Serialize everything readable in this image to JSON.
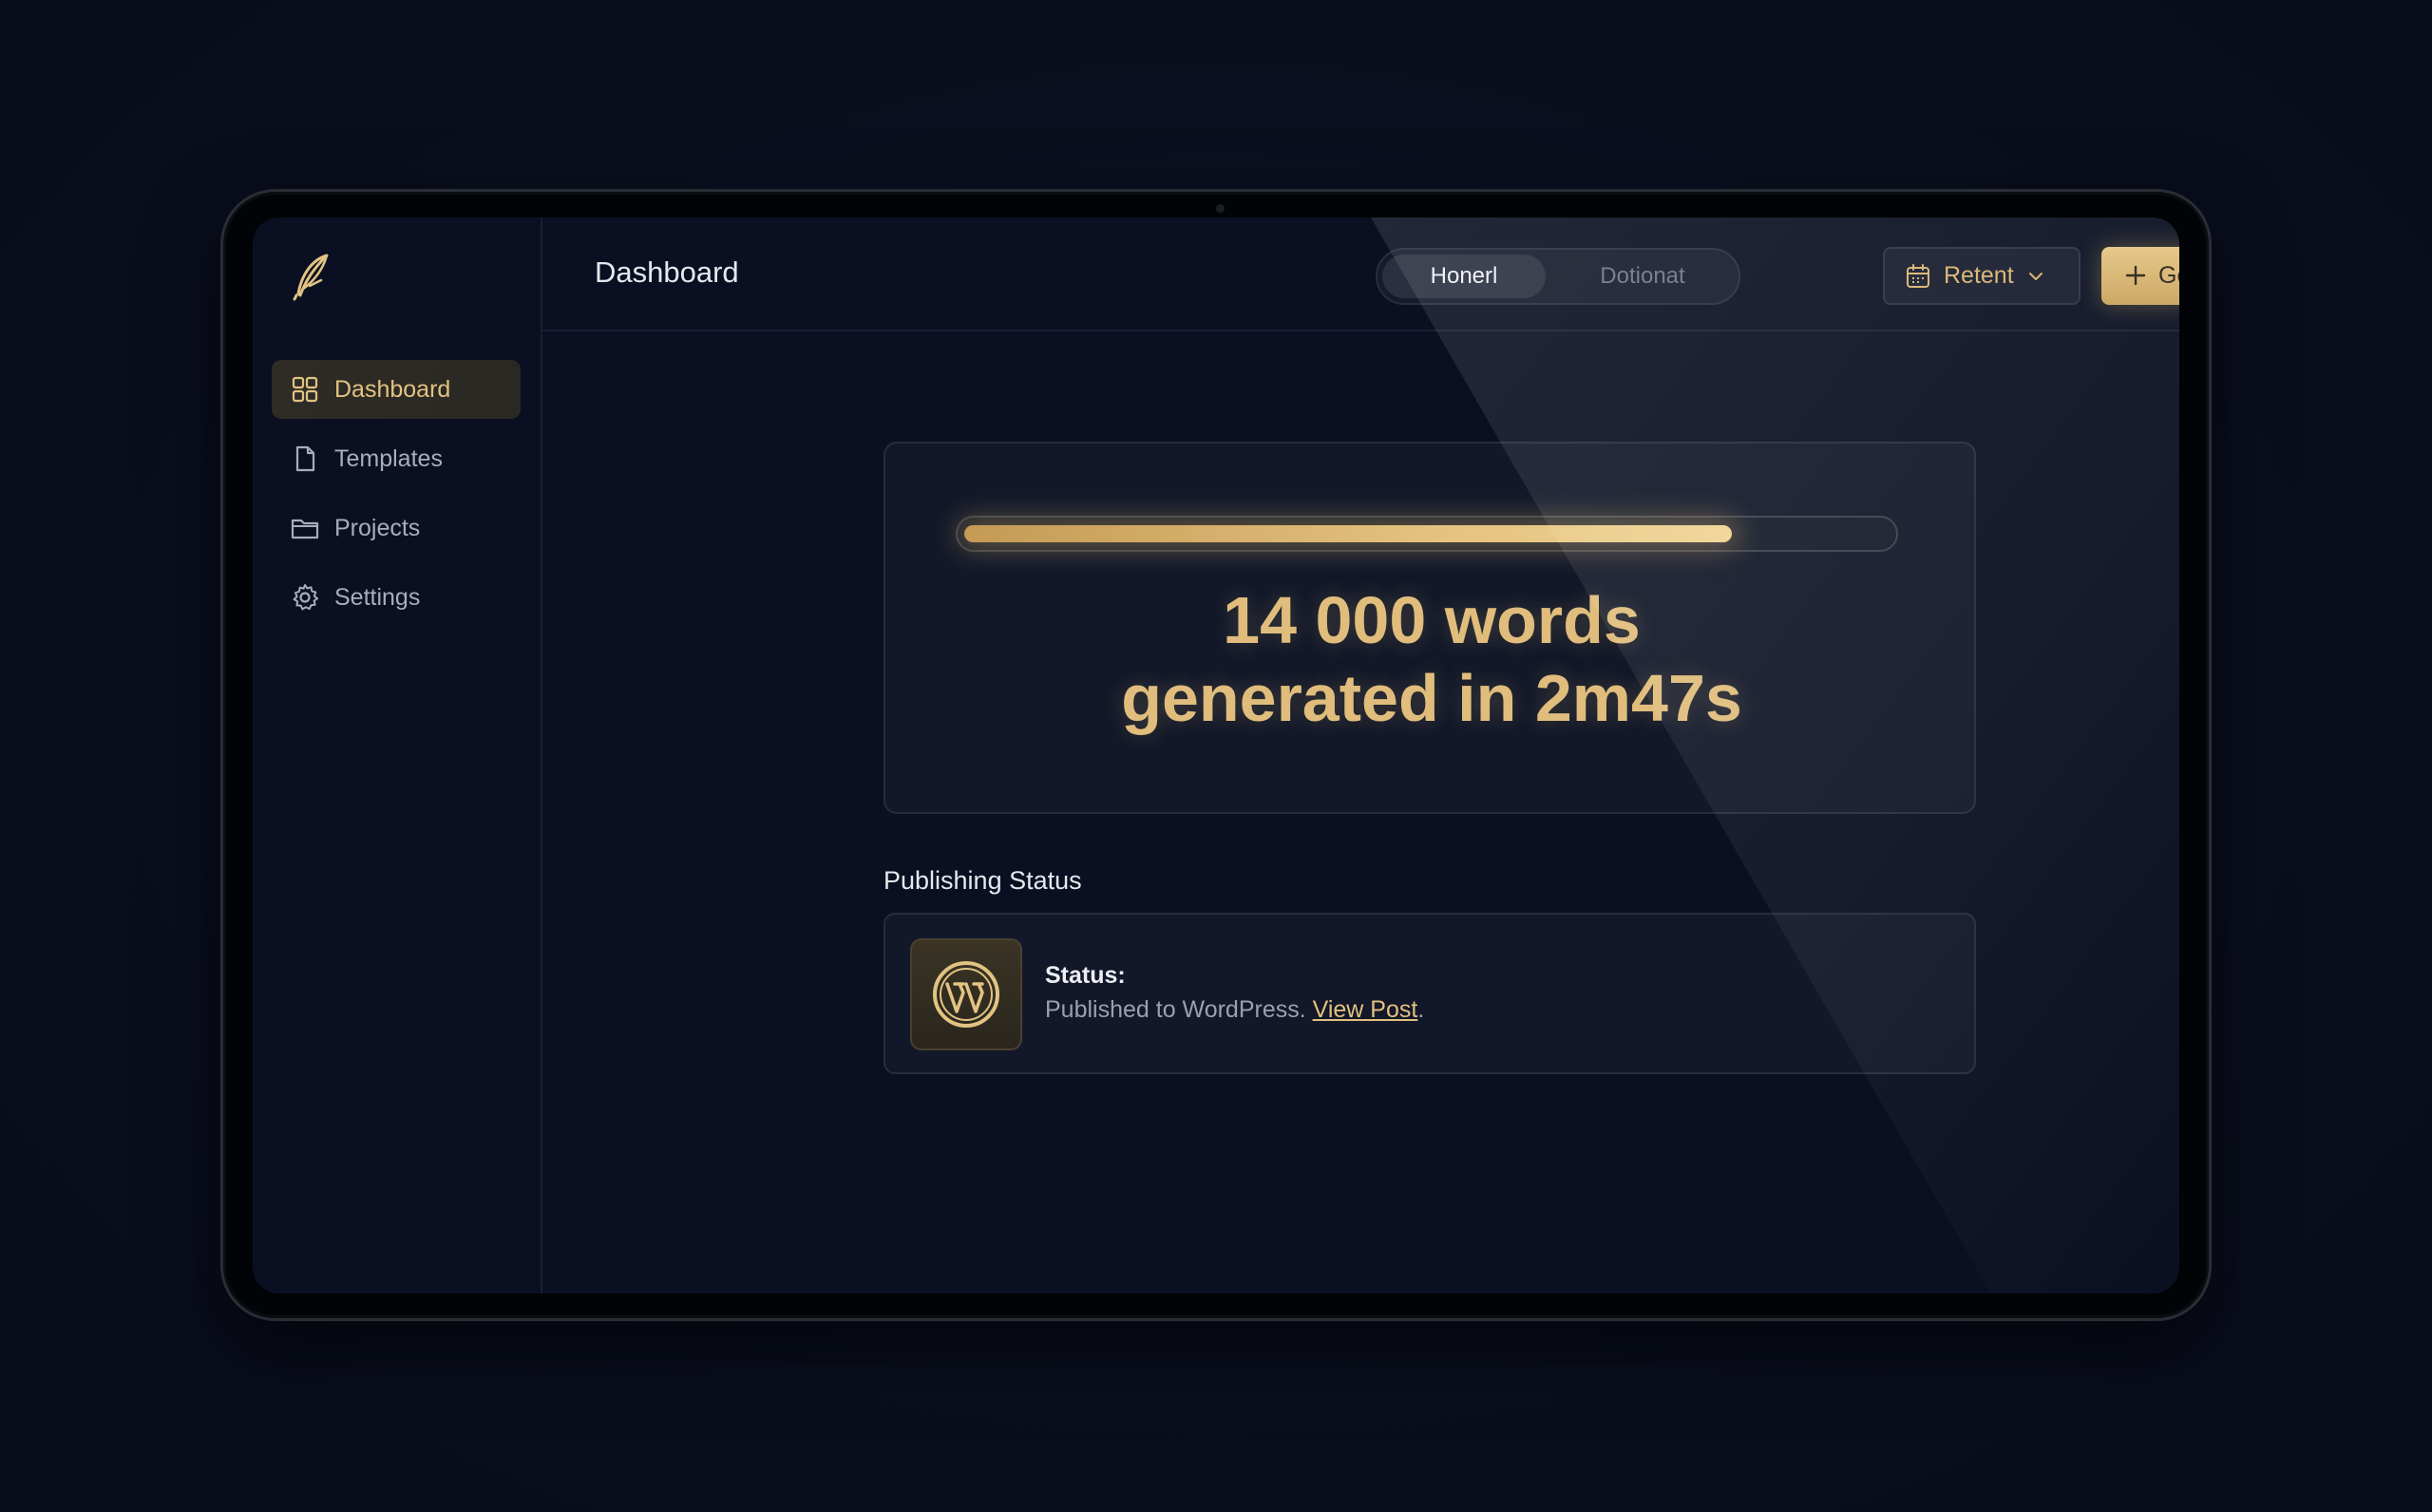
{
  "sidebar": {
    "logo_icon": "feather-quill-icon",
    "items": [
      {
        "label": "Dashboard",
        "icon": "grid-icon",
        "active": true
      },
      {
        "label": "Templates",
        "icon": "document-icon",
        "active": false
      },
      {
        "label": "Projects",
        "icon": "folder-icon",
        "active": false
      },
      {
        "label": "Settings",
        "icon": "gear-icon",
        "active": false
      }
    ]
  },
  "header": {
    "title": "Dashboard",
    "toggle": {
      "options": [
        "Honerl",
        "Dotionat"
      ],
      "selected": "Honerl"
    },
    "date_filter": {
      "label": "Retent",
      "icon": "calendar-icon"
    },
    "primary_button": {
      "label": "Generated",
      "icon": "plus-icon"
    },
    "notifications_icon": "bell-icon"
  },
  "result": {
    "progress": 0.83,
    "line1": "14 000 words",
    "line2": "generated in 2m47s"
  },
  "publishing": {
    "section_title": "Publishing Status",
    "icon": "wordpress-icon",
    "status_label": "Status:",
    "status_text": "Published to WordPress. ",
    "link_text": "View Post",
    "trailing": "."
  },
  "colors": {
    "accent_gold": "#e0bd7c",
    "background": "#0a1022",
    "text_primary": "#e6e8ee",
    "text_muted": "#9aa0ad"
  }
}
